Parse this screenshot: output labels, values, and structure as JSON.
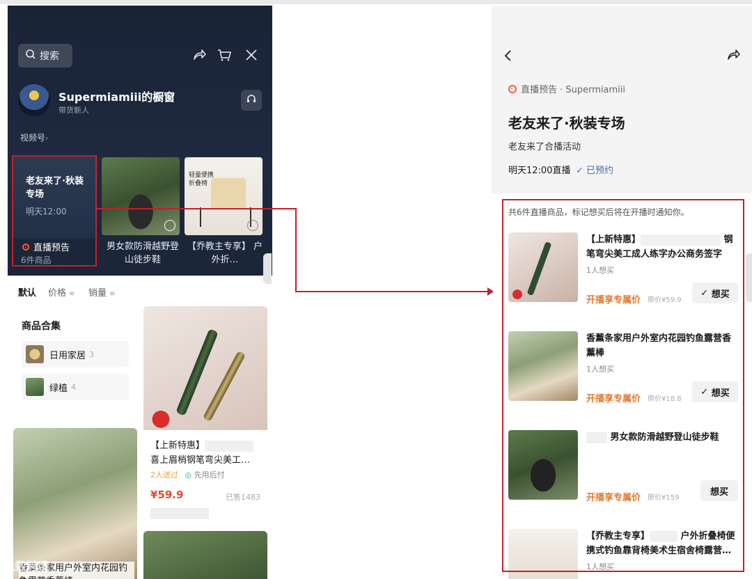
{
  "left": {
    "search_label": "搜索",
    "shop_name": "Supermiamiii的橱窗",
    "shop_subtitle": "带货新人",
    "channel_link": "视频号",
    "live_card": {
      "title": "老友来了·秋装专场",
      "time": "明天12:00"
    },
    "live_preview_label": "直播预告",
    "goods_count": "6件商品",
    "thumb2_caption": "男女款防滑越野登山徒步鞋",
    "thumb3_caption": "【乔教主专享】    户外折…",
    "thumb3_text": "轻量便携折叠椅",
    "sort": {
      "default": "默认",
      "price": "价格",
      "sales": "销量"
    },
    "collection": {
      "title": "商品合集",
      "items": [
        {
          "label": "日用家居",
          "count": "3"
        },
        {
          "label": "绿植",
          "count": "4"
        }
      ]
    },
    "pen_card": {
      "title": "【上新特惠】",
      "title2": "喜上眉梢钢笔弯尖美工…",
      "sent": "2人送过",
      "pay_later": "先用后付",
      "price": "¥59.9",
      "sold": "已售1483"
    },
    "incense_card_text": "香薰条家用户外室内花园钓鱼露营香薰棒"
  },
  "right": {
    "live_tag": "直播预告 · Supermiamiii",
    "title": "老友来了·秋装专场",
    "subtitle": "老友来了合播活动",
    "time": "明天12:00直播",
    "booked": "已预约",
    "notice": "共6件直播商品，标记想买后将在开播时通知你。",
    "products": [
      {
        "name_a": "【上新特惠】",
        "name_b": "钢",
        "name_c": "笔弯尖美工成人练字办公商务签字",
        "wants": "1人想买",
        "price": "开播享专属价",
        "orig": "原价¥59.9",
        "btn": "想买"
      },
      {
        "name_a": "香薰条家用户外室内花园钓鱼露营香",
        "name_b": "",
        "name_c": "薰棒",
        "wants": "1人想买",
        "price": "开播享专属价",
        "orig": "原价¥18.8",
        "btn": "想买"
      },
      {
        "name_a": "",
        "name_b": "",
        "name_c": "男女款防滑越野登山徒步鞋",
        "wants": "",
        "price": "开播享专属价",
        "orig": "原价¥159",
        "btn": "想买"
      },
      {
        "name_a": "【乔教主专享】",
        "name_b": "户外折叠椅便",
        "name_c": "携式钓鱼靠背椅美术生宿舍椅露营…",
        "wants": "1人想买",
        "price": "",
        "orig": "",
        "btn": ""
      }
    ]
  },
  "watermark": "大数跨境"
}
